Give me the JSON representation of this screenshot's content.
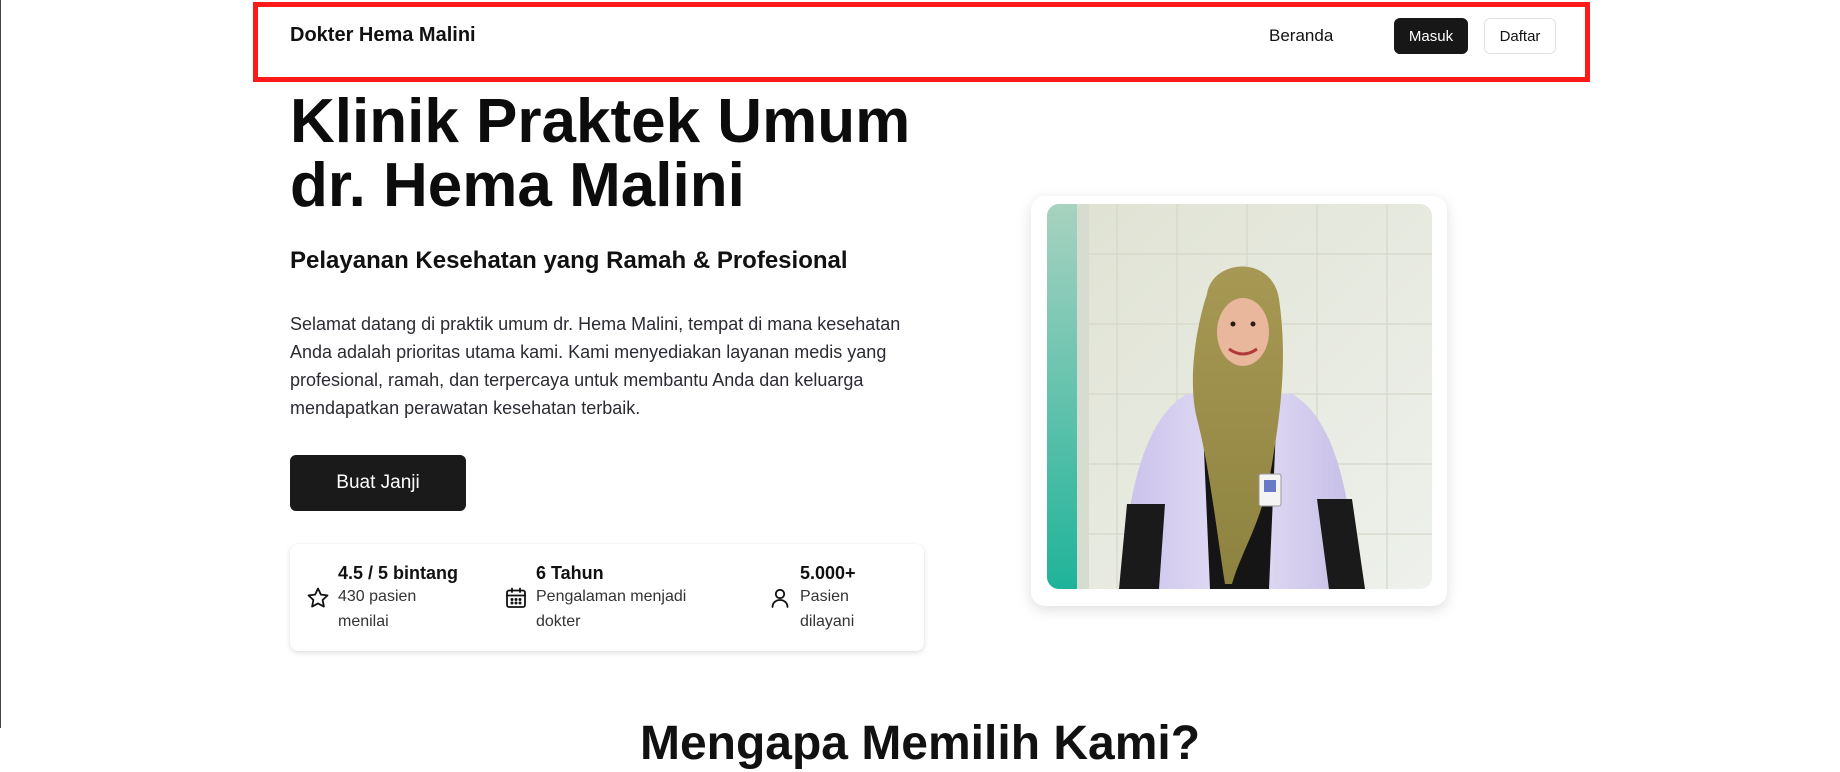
{
  "header": {
    "brand": "Dokter Hema Malini",
    "nav_home": "Beranda",
    "login_label": "Masuk",
    "register_label": "Daftar"
  },
  "hero": {
    "title_line1": "Klinik Praktek Umum",
    "title_line2": "dr. Hema Malini",
    "subtitle": "Pelayanan Kesehatan yang Ramah & Profesional",
    "description": "Selamat datang di praktik umum dr. Hema Malini, tempat di mana kesehatan Anda adalah prioritas utama kami. Kami menyediakan layanan medis yang profesional, ramah, dan terpercaya untuk membantu Anda dan keluarga mendapatkan perawatan kesehatan terbaik.",
    "cta_label": "Buat Janji"
  },
  "stats": [
    {
      "icon": "star-icon",
      "title": "4.5 / 5 bintang",
      "subtitle": "430 pasien menilai"
    },
    {
      "icon": "calendar-icon",
      "title": "6 Tahun",
      "subtitle": "Pengalaman menjadi dokter"
    },
    {
      "icon": "user-icon",
      "title": "5.000+",
      "subtitle": "Pasien dilayani"
    }
  ],
  "next_section": {
    "title": "Mengapa Memilih Kami?"
  },
  "colors": {
    "primary_button": "#171717",
    "highlight_border": "#ff1a1a",
    "text": "#111111"
  }
}
